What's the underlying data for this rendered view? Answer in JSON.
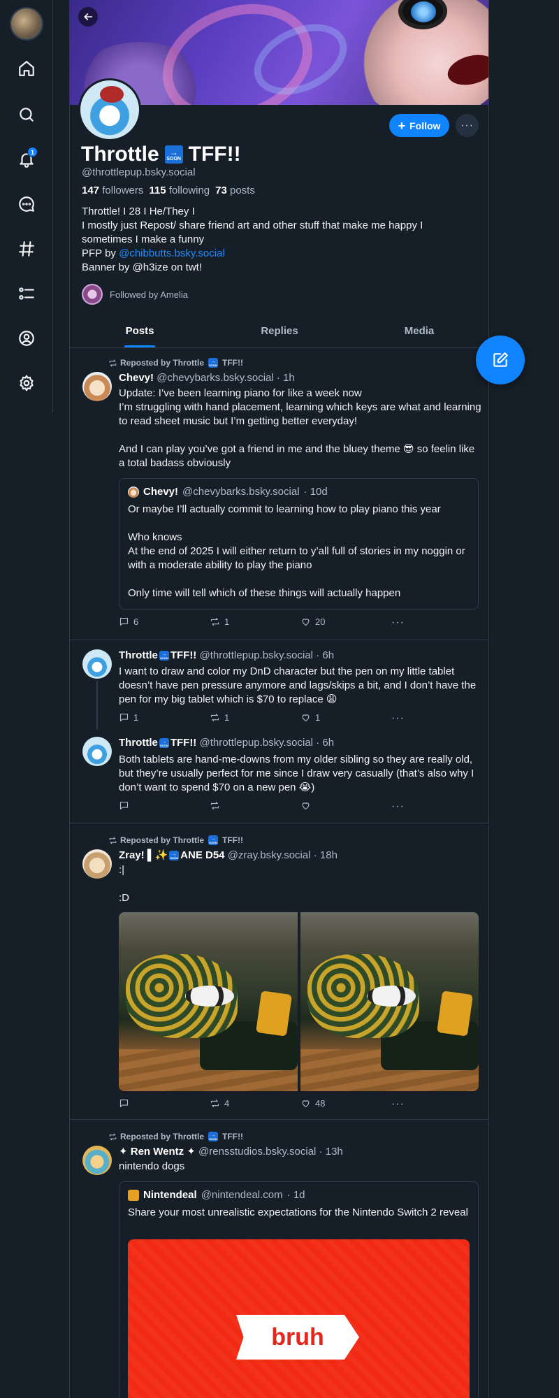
{
  "nav": {
    "items": [
      {
        "name": "home"
      },
      {
        "name": "search"
      },
      {
        "name": "notifications",
        "badge": "1"
      },
      {
        "name": "chat"
      },
      {
        "name": "feeds"
      },
      {
        "name": "lists"
      },
      {
        "name": "profile"
      },
      {
        "name": "settings"
      }
    ]
  },
  "profile": {
    "name_part1": "Throttle",
    "soon_label": "SOON",
    "name_part2": "TFF!!",
    "handle": "@throttlepup.bsky.social",
    "followers_count": "147",
    "followers_label": "followers",
    "following_count": "115",
    "following_label": "following",
    "posts_count": "73",
    "posts_label": "posts",
    "bio_line1": "Throttle! I 28 I He/They I",
    "bio_line2": "I mostly just Repost/ share friend art and other stuff that make me happy I sometimes I make a funny",
    "bio_pfp_prefix": "PFP by ",
    "bio_pfp_link": "@chibbutts.bsky.social",
    "bio_line4": "Banner by @h3ize on twt!",
    "followed_by": "Followed by Amelia",
    "follow_label": "Follow",
    "more_label": "···"
  },
  "tabs": [
    "Posts",
    "Replies",
    "Media"
  ],
  "posts": [
    {
      "reposted_by": "Reposted by Throttle",
      "reposted_by_suffix": "TFF!!",
      "author": "Chevy!",
      "handle": "@chevybarks.bsky.social",
      "time": "· 1h",
      "text": "Update: I’ve been learning piano for like a week now\nI’m struggling with hand placement, learning which keys are what and learning to read sheet music but I’m getting better everyday!\n\nAnd I can play you’ve got a friend in me and the bluey theme 😎 so feelin like a total badass obviously",
      "quote": {
        "author": "Chevy!",
        "handle": "@chevybarks.bsky.social",
        "time": "· 10d",
        "text": "Or maybe I’ll actually commit to learning how to play piano this year\n\nWho knows\nAt the end of 2025 I will either return to y’all full of stories in my noggin or with a moderate ability to play the piano\n\nOnly time will tell which of these things will actually happen"
      },
      "replies": "6",
      "reposts": "1",
      "likes": "20"
    },
    {
      "author": "Throttle",
      "author_suffix": "TFF!!",
      "handle": "@throttlepup.bsky.social",
      "time": "· 6h",
      "text": "I want to draw and color my DnD character but the pen on my little tablet doesn’t have pen pressure anymore and lags/skips a bit, and I don’t have the pen for my big tablet which is $70 to replace 😩",
      "replies": "1",
      "reposts": "1",
      "likes": "1"
    },
    {
      "author": "Throttle",
      "author_suffix": "TFF!!",
      "handle": "@throttlepup.bsky.social",
      "time": "· 6h",
      "text": "Both tablets are hand-me-downs from my older sibling so they are really old, but they’re usually perfect for me since I draw very casually (that’s also why I don’t want to spend $70 on a new pen 😭)",
      "replies": "",
      "reposts": "",
      "likes": ""
    },
    {
      "reposted_by": "Reposted by Throttle",
      "reposted_by_suffix": "TFF!!",
      "author": "Zray! ▌✨",
      "author_suffix": "ANE D54",
      "handle": "@zray.bsky.social",
      "time": "· 18h",
      "text": ":|\n\n:D",
      "replies": "",
      "reposts": "4",
      "likes": "48"
    },
    {
      "reposted_by": "Reposted by Throttle",
      "reposted_by_suffix": "TFF!!",
      "author": "✦ Ren Wentz ✦",
      "handle": "@rensstudios.bsky.social",
      "time": "· 13h",
      "text": "nintendo dogs",
      "quote": {
        "author": "Nintendeal",
        "handle": "@nintendeal.com",
        "time": "· 1d",
        "text": "Share your most unrealistic expectations for the Nintendo Switch 2 reveal",
        "card_text": "bruh"
      }
    }
  ],
  "colors": {
    "accent": "#1083fe",
    "background": "#161e27",
    "border": "#2e3d4d",
    "muted": "#aebbc9",
    "card_red": "#f22a14"
  }
}
